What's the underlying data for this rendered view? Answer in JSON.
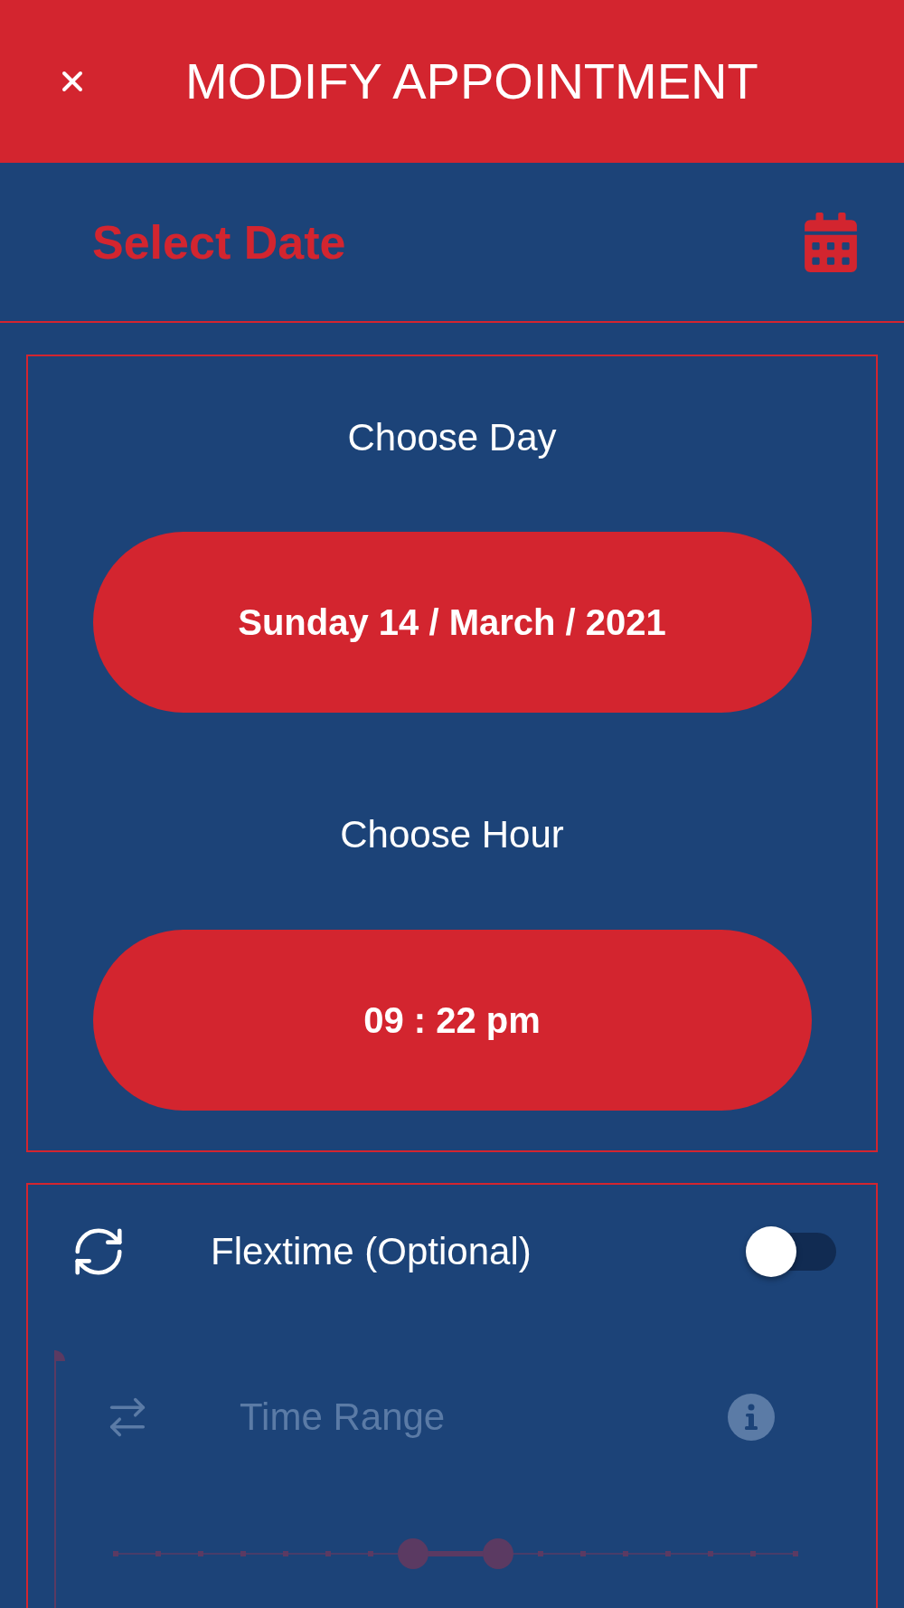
{
  "header": {
    "title": "MODIFY APPOINTMENT"
  },
  "section": {
    "title": "Select Date"
  },
  "date_card": {
    "fields": [
      {
        "label": "Choose Day",
        "value": "Sunday 14 / March / 2021"
      },
      {
        "label": "Choose Hour",
        "value": "09 : 22 pm"
      }
    ]
  },
  "flextime": {
    "label": "Flextime (Optional)",
    "on": false
  },
  "time_range": {
    "label": "Time Range",
    "disabled": true,
    "slider": {
      "thumbs": [
        {
          "level": 0.4375
        },
        {
          "level": 0.5625
        }
      ]
    }
  }
}
